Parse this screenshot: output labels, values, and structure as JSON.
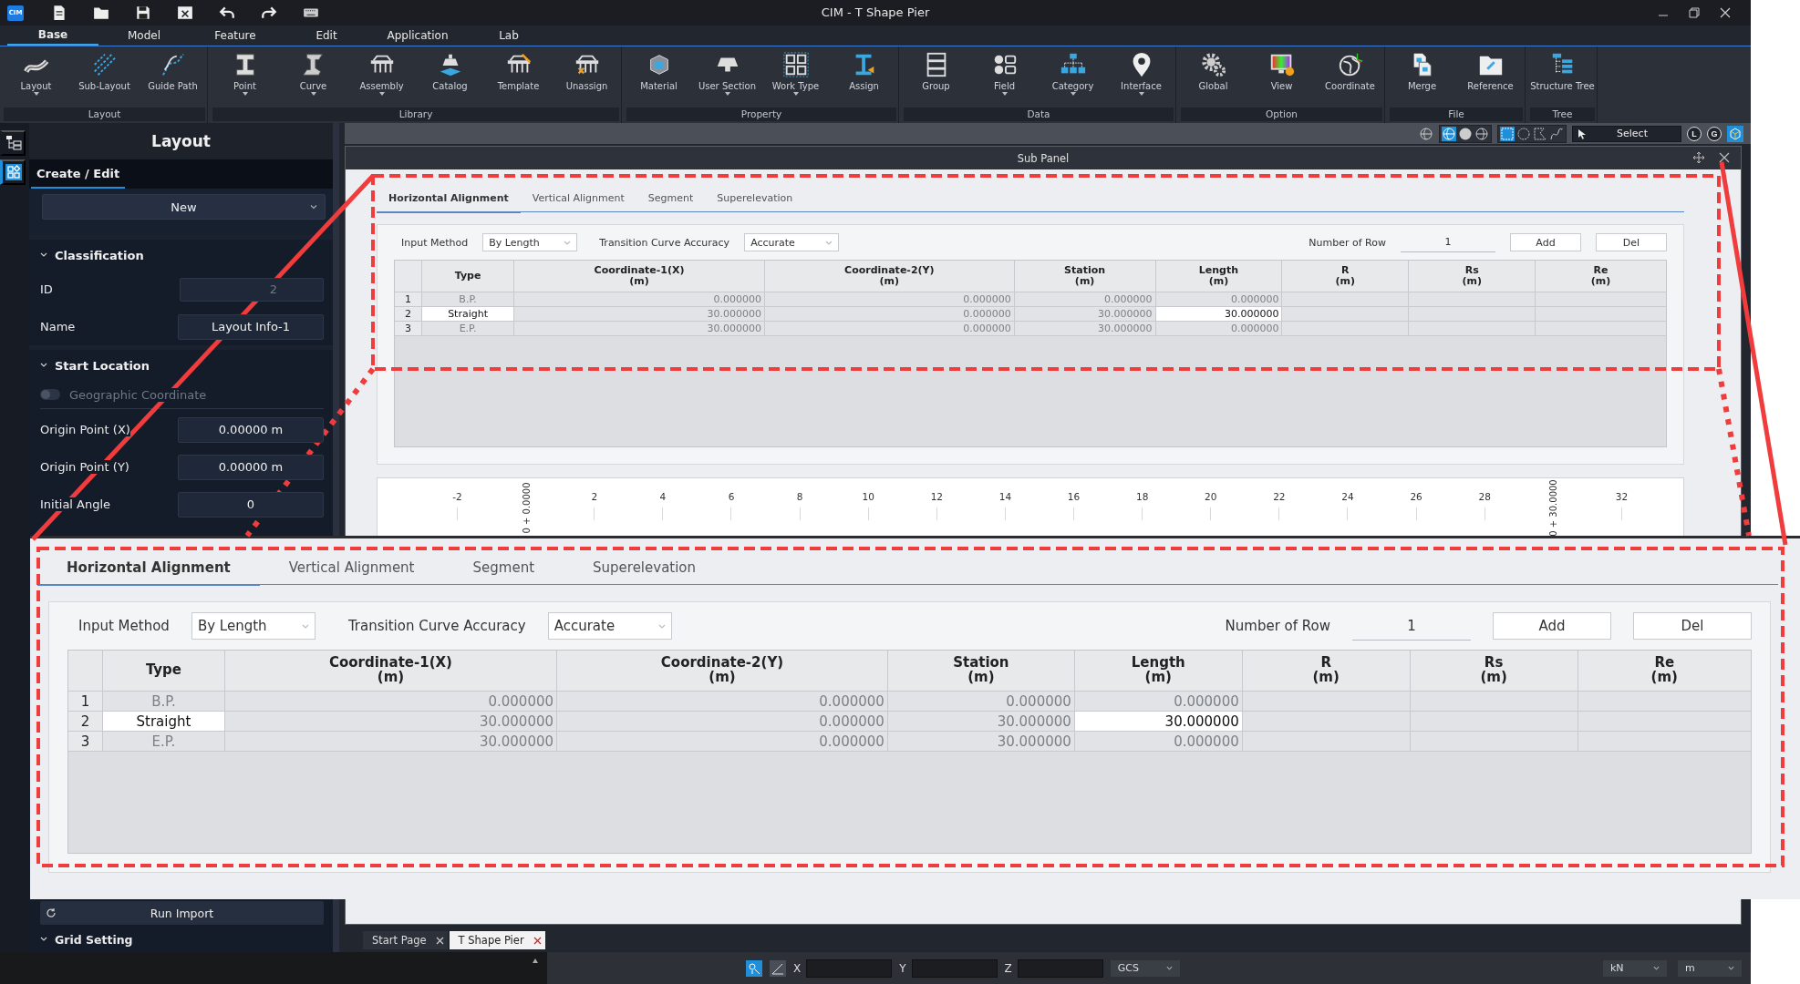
{
  "window": {
    "app_badge": "CIM",
    "title": "CIM - T Shape Pier"
  },
  "menu_tabs": [
    {
      "label": "Base",
      "selected": true
    },
    {
      "label": "Model",
      "selected": false
    },
    {
      "label": "Feature",
      "selected": false
    },
    {
      "label": "Edit",
      "selected": false
    },
    {
      "label": "Application",
      "selected": false
    },
    {
      "label": "Lab",
      "selected": false
    }
  ],
  "ribbon": [
    {
      "group": "Layout",
      "items": [
        {
          "label": "Layout",
          "dropdown": true
        },
        {
          "label": "Sub-Layout",
          "dropdown": false
        },
        {
          "label": "Guide Path",
          "dropdown": false
        }
      ]
    },
    {
      "group": "Library",
      "items": [
        {
          "label": "Point",
          "dropdown": true
        },
        {
          "label": "Curve",
          "dropdown": true
        },
        {
          "label": "Assembly",
          "dropdown": true
        },
        {
          "label": "Catalog",
          "dropdown": false
        },
        {
          "label": "Template",
          "dropdown": false
        },
        {
          "label": "Unassign",
          "dropdown": false
        }
      ]
    },
    {
      "group": "Property",
      "items": [
        {
          "label": "Material",
          "dropdown": false
        },
        {
          "label": "User Section",
          "dropdown": true
        },
        {
          "label": "Work Type",
          "dropdown": true
        },
        {
          "label": "Assign",
          "dropdown": false
        }
      ]
    },
    {
      "group": "Data",
      "items": [
        {
          "label": "Group",
          "dropdown": false
        },
        {
          "label": "Field",
          "dropdown": true
        },
        {
          "label": "Category",
          "dropdown": true
        },
        {
          "label": "Interface",
          "dropdown": true
        }
      ]
    },
    {
      "group": "Option",
      "items": [
        {
          "label": "Global",
          "dropdown": false
        },
        {
          "label": "View",
          "dropdown": false
        },
        {
          "label": "Coordinate",
          "dropdown": false
        }
      ]
    },
    {
      "group": "File",
      "items": [
        {
          "label": "Merge",
          "dropdown": false
        },
        {
          "label": "Reference",
          "dropdown": false
        }
      ]
    },
    {
      "group": "Tree",
      "items": [
        {
          "label": "Structure Tree",
          "dropdown": false
        }
      ]
    }
  ],
  "view_bar": {
    "select_mode": "Select",
    "toggles": [
      "L",
      "G"
    ]
  },
  "side_rail": [
    {
      "selected": false
    },
    {
      "selected": true
    }
  ],
  "left_panel": {
    "title": "Layout",
    "tabs": [
      {
        "label": "Create / Edit",
        "selected": true
      }
    ],
    "mode": "New",
    "sections": [
      {
        "title": "Classification",
        "expanded": true,
        "fields": [
          {
            "label": "ID",
            "value": "2",
            "disabled": true
          },
          {
            "label": "Name",
            "value": "Layout Info-1",
            "disabled": false
          }
        ]
      },
      {
        "title": "Start Location",
        "expanded": true,
        "toggle": {
          "label": "Geographic Coordinate",
          "on": false
        },
        "fields": [
          {
            "label": "Origin Point (X)",
            "value": "0.00000 m",
            "disabled": false
          },
          {
            "label": "Origin Point (Y)",
            "value": "0.00000 m",
            "disabled": false
          },
          {
            "label": "Initial Angle",
            "value": "0",
            "disabled": false
          }
        ]
      }
    ],
    "import_button": "Run Import",
    "lower_sections": [
      {
        "title": "Grid Setting",
        "expanded": true
      }
    ]
  },
  "sub_panel": {
    "title": "Sub Panel",
    "alignment": {
      "tabs": [
        {
          "label": "Horizontal Alignment",
          "selected": true
        },
        {
          "label": "Vertical Alignment",
          "selected": false
        },
        {
          "label": "Segment",
          "selected": false
        },
        {
          "label": "Superelevation",
          "selected": false
        }
      ],
      "input_method": {
        "label": "Input Method",
        "value": "By Length"
      },
      "accuracy": {
        "label": "Transition Curve Accuracy",
        "value": "Accurate"
      },
      "row_count": {
        "label": "Number of Row",
        "value": "1"
      },
      "buttons": [
        "Add",
        "Del"
      ],
      "columns": [
        {
          "name": "Type"
        },
        {
          "name": "Coordinate-1(X)",
          "unit": "(m)"
        },
        {
          "name": "Coordinate-2(Y)",
          "unit": "(m)"
        },
        {
          "name": "Station",
          "unit": "(m)"
        },
        {
          "name": "Length",
          "unit": "(m)"
        },
        {
          "name": "R",
          "unit": "(m)"
        },
        {
          "name": "Rs",
          "unit": "(m)"
        },
        {
          "name": "Re",
          "unit": "(m)"
        }
      ],
      "rows": [
        {
          "number": "1",
          "cells": [
            {
              "text": "B.P.",
              "editable": false
            },
            {
              "text": "0.000000",
              "editable": false
            },
            {
              "text": "0.000000",
              "editable": false
            },
            {
              "text": "0.000000",
              "editable": false
            },
            {
              "text": "0.000000",
              "editable": false
            }
          ]
        },
        {
          "number": "2",
          "cells": [
            {
              "text": "Straight",
              "editable": true
            },
            {
              "text": "30.000000",
              "editable": false
            },
            {
              "text": "0.000000",
              "editable": false
            },
            {
              "text": "30.000000",
              "editable": false
            },
            {
              "text": "30.000000",
              "editable": true
            }
          ]
        },
        {
          "number": "3",
          "cells": [
            {
              "text": "E.P.",
              "editable": false
            },
            {
              "text": "30.000000",
              "editable": false
            },
            {
              "text": "0.000000",
              "editable": false
            },
            {
              "text": "30.000000",
              "editable": false
            },
            {
              "text": "0.000000",
              "editable": false
            }
          ]
        }
      ]
    },
    "ruler": [
      {
        "kind": "tick",
        "text": "-2"
      },
      {
        "kind": "station",
        "text": "0 + 0.0000"
      },
      {
        "kind": "tick",
        "text": "2"
      },
      {
        "kind": "tick",
        "text": "4"
      },
      {
        "kind": "tick",
        "text": "6"
      },
      {
        "kind": "tick",
        "text": "8"
      },
      {
        "kind": "tick",
        "text": "10"
      },
      {
        "kind": "tick",
        "text": "12"
      },
      {
        "kind": "tick",
        "text": "14"
      },
      {
        "kind": "tick",
        "text": "16"
      },
      {
        "kind": "tick",
        "text": "18"
      },
      {
        "kind": "tick",
        "text": "20"
      },
      {
        "kind": "tick",
        "text": "22"
      },
      {
        "kind": "tick",
        "text": "24"
      },
      {
        "kind": "tick",
        "text": "26"
      },
      {
        "kind": "tick",
        "text": "28"
      },
      {
        "kind": "station",
        "text": "0 + 30.0000"
      },
      {
        "kind": "tick",
        "text": "32"
      }
    ]
  },
  "zoom_inset": {
    "alignment": {
      "tabs": [
        {
          "label": "Horizontal Alignment",
          "selected": true
        },
        {
          "label": "Vertical Alignment",
          "selected": false
        },
        {
          "label": "Segment",
          "selected": false
        },
        {
          "label": "Superelevation",
          "selected": false
        }
      ],
      "input_method": {
        "label": "Input Method",
        "value": "By Length"
      },
      "accuracy": {
        "label": "Transition Curve Accuracy",
        "value": "Accurate"
      },
      "row_count": {
        "label": "Number of Row",
        "value": "1"
      },
      "buttons": [
        "Add",
        "Del"
      ],
      "columns": [
        {
          "name": "Type"
        },
        {
          "name": "Coordinate-1(X)",
          "unit": "(m)"
        },
        {
          "name": "Coordinate-2(Y)",
          "unit": "(m)"
        },
        {
          "name": "Station",
          "unit": "(m)"
        },
        {
          "name": "Length",
          "unit": "(m)"
        },
        {
          "name": "R",
          "unit": "(m)"
        },
        {
          "name": "Rs",
          "unit": "(m)"
        },
        {
          "name": "Re",
          "unit": "(m)"
        }
      ],
      "rows": [
        {
          "number": "1",
          "cells": [
            {
              "text": "B.P.",
              "editable": false
            },
            {
              "text": "0.000000",
              "editable": false
            },
            {
              "text": "0.000000",
              "editable": false
            },
            {
              "text": "0.000000",
              "editable": false
            },
            {
              "text": "0.000000",
              "editable": false
            }
          ]
        },
        {
          "number": "2",
          "cells": [
            {
              "text": "Straight",
              "editable": true
            },
            {
              "text": "30.000000",
              "editable": false
            },
            {
              "text": "0.000000",
              "editable": false
            },
            {
              "text": "30.000000",
              "editable": false
            },
            {
              "text": "30.000000",
              "editable": true
            }
          ]
        },
        {
          "number": "3",
          "cells": [
            {
              "text": "E.P.",
              "editable": false
            },
            {
              "text": "30.000000",
              "editable": false
            },
            {
              "text": "0.000000",
              "editable": false
            },
            {
              "text": "30.000000",
              "editable": false
            },
            {
              "text": "0.000000",
              "editable": false
            }
          ]
        }
      ]
    }
  },
  "document_tabs": [
    {
      "label": "Start Page",
      "selected": false
    },
    {
      "label": "T Shape Pier",
      "selected": true
    }
  ],
  "status_bar": {
    "coords": [
      {
        "label": "X"
      },
      {
        "label": "Y"
      },
      {
        "label": "Z"
      }
    ],
    "system": "GCS",
    "force_unit": "kN",
    "length_unit": "m"
  }
}
